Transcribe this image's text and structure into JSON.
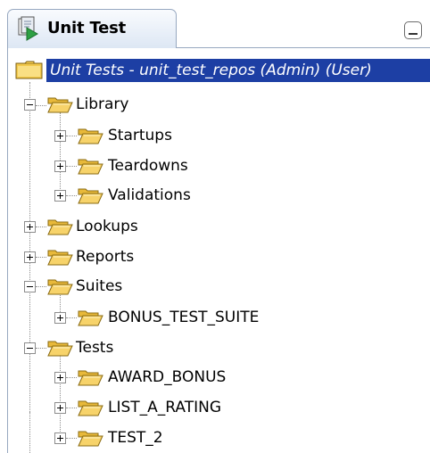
{
  "tab": {
    "title": "Unit Test"
  },
  "tree": {
    "root_label": "Unit Tests - unit_test_repos (Admin) (User)",
    "library": "Library",
    "startups": "Startups",
    "teardowns": "Teardowns",
    "validations": "Validations",
    "lookups": "Lookups",
    "reports": "Reports",
    "suites": "Suites",
    "bonus_test_suite": "BONUS_TEST_SUITE",
    "tests": "Tests",
    "award_bonus": "AWARD_BONUS",
    "list_a_rating": "LIST_A_RATING",
    "test_2": "TEST_2"
  },
  "colors": {
    "selection": "#1d3fa4",
    "folder": "#f2c54a",
    "tab_border": "#97a8c0"
  }
}
